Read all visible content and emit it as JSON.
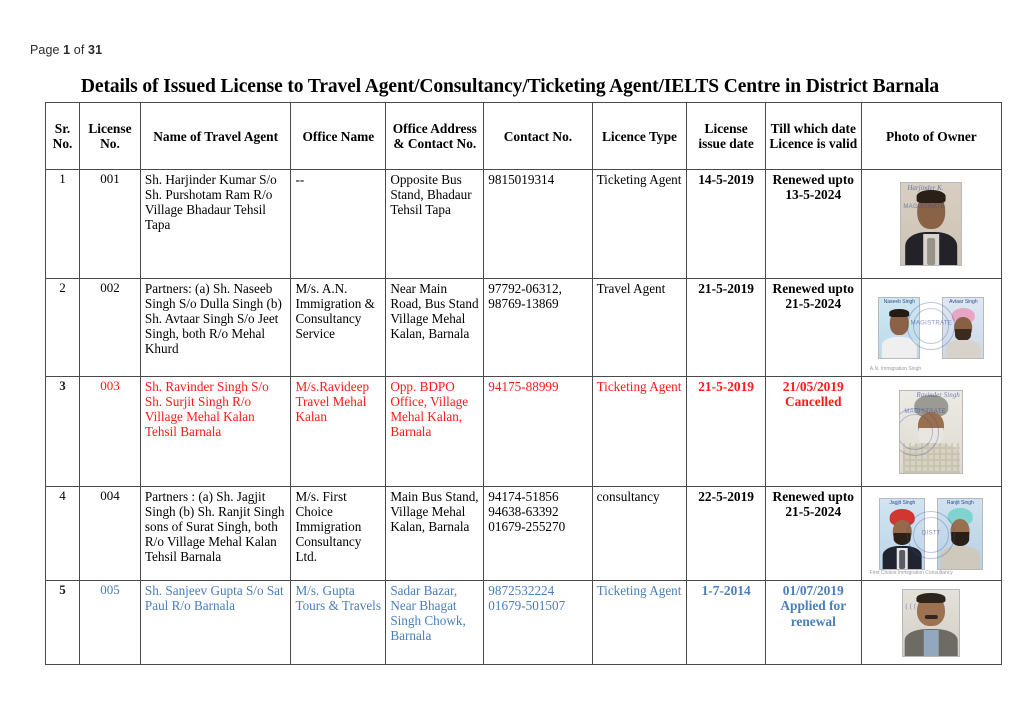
{
  "page_header": {
    "prefix": "Page ",
    "current": "1",
    "middle": " of ",
    "total": "31"
  },
  "document": {
    "title": "Details of Issued License to Travel Agent/Consultancy/Ticketing Agent/IELTS Centre in District Barnala"
  },
  "colors": {
    "text": "#000000",
    "cancelled": "#ff1a1a",
    "applied_for_renewal": "#4a7ebb",
    "border": "#4a4a4a"
  },
  "table": {
    "headers": [
      "Sr. No.",
      "License No.",
      "Name of Travel Agent",
      "Office Name",
      "Office Address & Contact No.",
      "Contact No.",
      "Licence Type",
      "License issue date",
      "Till which date Licence is valid",
      "Photo of Owner"
    ],
    "rows": [
      {
        "sr_no": "1",
        "license_no": "001",
        "name": "Sh. Harjinder Kumar S/o Sh. Purshotam Ram R/o Village Bhadaur Tehsil Tapa",
        "office_name": "--",
        "office_address": "Opposite Bus Stand, Bhadaur Tehsil Tapa",
        "contact_no": "9815019314",
        "licence_type": "Ticketing Agent",
        "issue_date": "14-5-2019",
        "valid_till": "Renewed upto 13-5-2024",
        "photo_alt": "passport photo of man in dark suit and tie",
        "status": "renewed"
      },
      {
        "sr_no": "2",
        "license_no": "002",
        "name": "Partners: (a) Sh. Naseeb Singh S/o Dulla Singh (b) Sh. Avtaar Singh S/o Jeet Singh, both R/o Mehal Khurd",
        "office_name": "M/s. A.N. Immigration & Consultancy Service",
        "office_address": "Near Main Road, Bus Stand Village Mehal Kalan, Barnala",
        "contact_no": "97792-06312, 98769-13869",
        "licence_type": "Travel Agent",
        "issue_date": "21-5-2019",
        "valid_till": "Renewed upto 21-5-2024",
        "photo_alt": "two passport photos with official blue stamp",
        "status": "renewed"
      },
      {
        "sr_no": "3",
        "license_no": "003",
        "name": "Sh. Ravinder Singh S/o Sh. Surjit Singh R/o Village Mehal Kalan Tehsil Barnala",
        "office_name": "M/s.Ravideep Travel Mehal Kalan",
        "office_address": "Opp. BDPO Office, Village Mehal Kalan, Barnala",
        "contact_no": "94175-88999",
        "licence_type": "Ticketing Agent",
        "issue_date": "21-5-2019",
        "valid_till": "21/05/2019 Cancelled",
        "photo_alt": "photo of elderly Sikh man with grey turban and white beard",
        "status": "cancelled"
      },
      {
        "sr_no": "4",
        "license_no": "004",
        "name": "Partners : (a) Sh. Jagjit Singh (b) Sh. Ranjit Singh sons of Surat Singh, both R/o Village Mehal Kalan Tehsil Barnala",
        "office_name": "M/s. First Choice Immigration Consultancy Ltd.",
        "office_address": "Main Bus Stand, Village Mehal Kalan, Barnala",
        "contact_no": "94174-51856 94638-63392 01679-255270",
        "licence_type": "consultancy",
        "issue_date": "22-5-2019",
        "valid_till": "Renewed upto 21-5-2024",
        "photo_alt": "two passport photos of Sikh men in red and teal turbans",
        "status": "renewed"
      },
      {
        "sr_no": "5",
        "license_no": "005",
        "name": "Sh. Sanjeev Gupta S/o Sat Paul  R/o Barnala",
        "office_name": "M/s. Gupta Tours & Travels",
        "office_address": "Sadar Bazar, Near Bhagat Singh Chowk, Barnala",
        "contact_no": "9872532224 01679-501507",
        "licence_type": "Ticketing Agent",
        "issue_date": "1-7-2014",
        "valid_till": "01/07/2019 Applied for renewal",
        "photo_alt": "photo of man with moustache in grey jacket",
        "status": "applied_for_renewal"
      }
    ]
  }
}
